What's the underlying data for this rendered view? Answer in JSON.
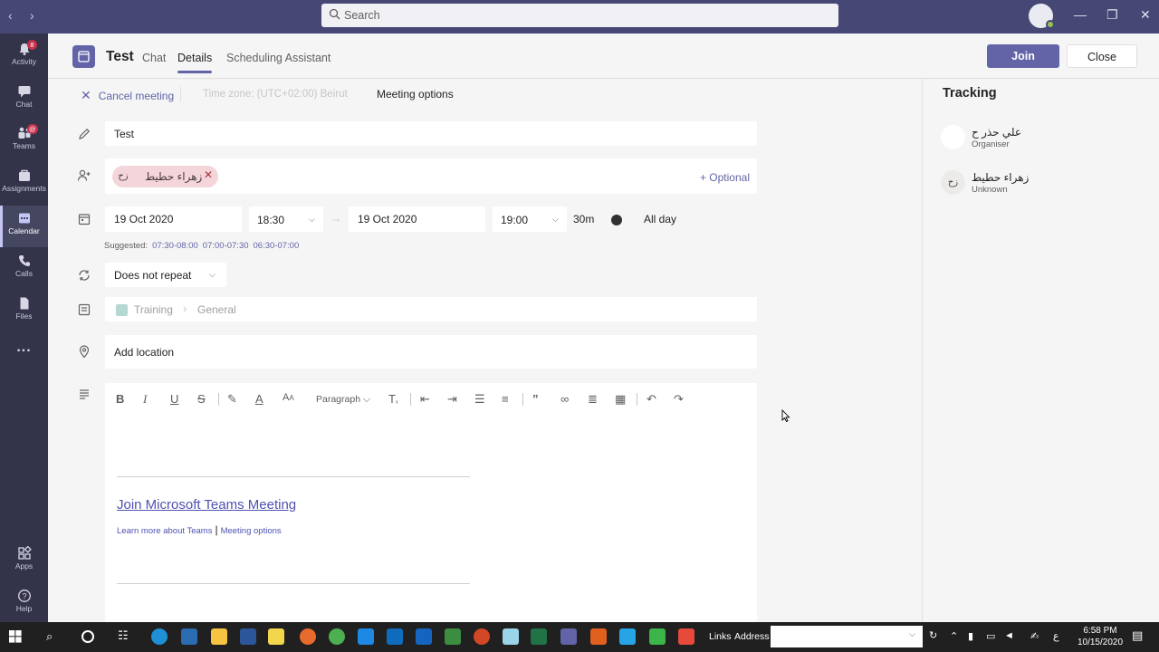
{
  "window": {
    "search_placeholder": "Search"
  },
  "rail": {
    "items": [
      {
        "label": "Activity",
        "badge": "8"
      },
      {
        "label": "Chat",
        "badge": ""
      },
      {
        "label": "Teams",
        "badge": "@"
      },
      {
        "label": "Assignments",
        "badge": ""
      },
      {
        "label": "Calendar",
        "badge": ""
      },
      {
        "label": "Calls",
        "badge": ""
      },
      {
        "label": "Files",
        "badge": ""
      },
      {
        "label": "...",
        "badge": ""
      },
      {
        "label": "Apps",
        "badge": ""
      },
      {
        "label": "Help",
        "badge": ""
      }
    ]
  },
  "header": {
    "title": "Test",
    "tabs": [
      "Chat",
      "Details",
      "Scheduling Assistant"
    ],
    "join_label": "Join",
    "close_label": "Close"
  },
  "subbar": {
    "cancel_label": "Cancel meeting",
    "timezone": "Time zone: (UTC+02:00) Beirut",
    "meeting_options": "Meeting options"
  },
  "form": {
    "title_value": "Test",
    "attendee": {
      "initials": "زح",
      "name": "زهراء حطيط"
    },
    "optional_label": "+ Optional",
    "start_date": "19 Oct 2020",
    "start_time": "18:30",
    "end_date": "19 Oct 2020",
    "end_time": "19:00",
    "duration": "30m",
    "all_day_label": "All day",
    "suggested_label": "Suggested:",
    "suggestions": [
      "07:30-08:00",
      "07:00-07:30",
      "06:30-07:00"
    ],
    "repeat_value": "Does not repeat",
    "channel": {
      "team": "Training",
      "channel": "General"
    },
    "location_placeholder": "Add location"
  },
  "editor": {
    "paragraph_label": "Paragraph",
    "join_link": "Join Microsoft Teams Meeting",
    "learn_more": "Learn more about Teams",
    "meeting_options_link": "Meeting options"
  },
  "tracking": {
    "title": "Tracking",
    "people": [
      {
        "name": "علي حذر ح",
        "role": "Organiser",
        "initials": ""
      },
      {
        "name": "زهراء حطيط",
        "role": "Unknown",
        "initials": "زح"
      }
    ]
  },
  "taskbar": {
    "links_label": "Links",
    "address_label": "Address",
    "language": "ع",
    "time": "6:58 PM",
    "date": "10/15/2020"
  },
  "colors": {
    "brand": "#6264a7",
    "titlebar": "#464775",
    "rail": "#33344a"
  }
}
